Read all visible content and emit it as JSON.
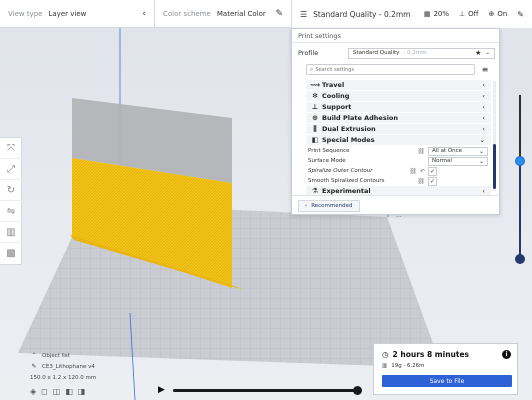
{
  "colors": {
    "accent": "#2d62d6",
    "brand_dark": "#243a6e",
    "model": "#f2c21b",
    "build_plate": "#c9ccd1"
  },
  "header": {
    "view_type_label": "View type",
    "view_type_value": "Layer view",
    "color_scheme_label": "Color scheme",
    "color_scheme_value": "Material Color",
    "quality_label": "Standard Quality - 0.2mm",
    "infill": "20%",
    "support": "Off",
    "adhesion": "On"
  },
  "left_tools": [
    "move-icon",
    "scale-icon",
    "rotate-icon",
    "mirror-icon",
    "per-model-settings-icon",
    "support-blocker-icon"
  ],
  "panel": {
    "title": "Print settings",
    "profile_label": "Profile",
    "profile_value": "Standard Quality",
    "profile_suffix": "- 0.2mm",
    "search_placeholder": "Search settings",
    "categories_top": [
      {
        "label": "Travel",
        "icon": "travel-icon"
      },
      {
        "label": "Cooling",
        "icon": "cooling-icon"
      },
      {
        "label": "Support",
        "icon": "support-icon"
      },
      {
        "label": "Build Plate Adhesion",
        "icon": "adhesion-icon"
      },
      {
        "label": "Dual Extrusion",
        "icon": "dual-extrusion-icon"
      },
      {
        "label": "Special Modes",
        "icon": "special-modes-icon"
      }
    ],
    "settings": [
      {
        "name": "Print Sequence",
        "type": "dropdown",
        "value": "All at Once"
      },
      {
        "name": "Surface Mode",
        "type": "dropdown",
        "value": "Normal"
      },
      {
        "name": "Spiralize Outer Contour",
        "type": "checkbox",
        "value": "✓"
      },
      {
        "name": "Smooth Spiralized Contours",
        "type": "checkbox",
        "value": "✓"
      }
    ],
    "category_bottom": {
      "label": "Experimental",
      "icon": "experimental-icon"
    },
    "recommended_label": "Recommended",
    "handle": "..."
  },
  "objects": {
    "list_label": "Object list",
    "file_name": "CE3_Lithophane v4",
    "dimensions": "150.0 x 1.2 x 120.0 mm"
  },
  "estimate": {
    "time": "2 hours 8 minutes",
    "material": "19g · 6.26m",
    "save_label": "Save to File"
  }
}
